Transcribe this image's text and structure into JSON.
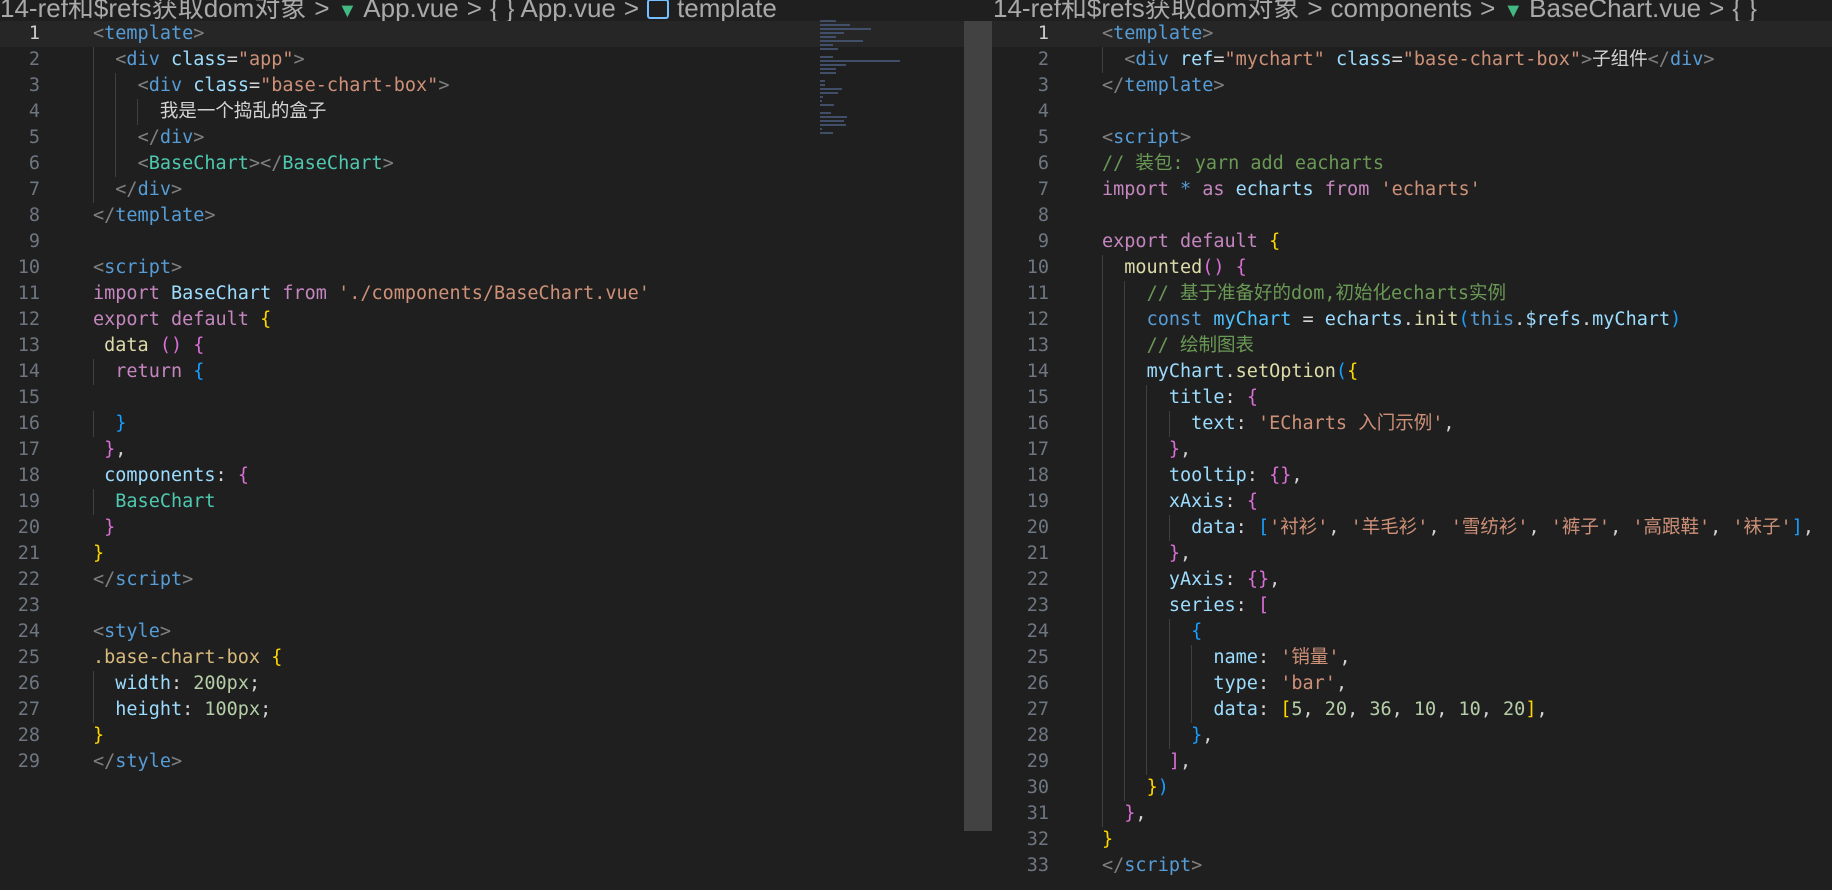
{
  "left_editor": {
    "breadcrumb": {
      "folder": "14-ref和$refs获取dom对象",
      "file": "App.vue",
      "symbol_file": "App.vue",
      "symbol": "template"
    },
    "active_line": 1,
    "line_numbers": [
      "1",
      "2",
      "3",
      "4",
      "5",
      "6",
      "7",
      "8",
      "9",
      "10",
      "11",
      "12",
      "13",
      "14",
      "15",
      "16",
      "17",
      "18",
      "19",
      "20",
      "21",
      "22",
      "23",
      "24",
      "25",
      "26",
      "27",
      "28",
      "29"
    ]
  },
  "right_editor": {
    "breadcrumb": {
      "folder": "14-ref和$refs获取dom对象",
      "subfolder": "components",
      "file": "BaseChart.vue",
      "symbol_file": "{ }"
    },
    "active_line": 1,
    "line_numbers": [
      "1",
      "2",
      "3",
      "4",
      "5",
      "6",
      "7",
      "8",
      "9",
      "10",
      "11",
      "12",
      "13",
      "14",
      "15",
      "16",
      "17",
      "18",
      "19",
      "20",
      "21",
      "22",
      "23",
      "24",
      "25",
      "26",
      "27",
      "28",
      "29",
      "30",
      "31",
      "32",
      "33"
    ]
  },
  "left_code": [
    [
      [
        "tg",
        "<"
      ],
      [
        "tn",
        "template"
      ],
      [
        "tg",
        ">"
      ]
    ],
    [
      [
        "tx",
        "  "
      ],
      [
        "tg",
        "<"
      ],
      [
        "tn",
        "div"
      ],
      [
        "tx",
        " "
      ],
      [
        "an",
        "class"
      ],
      [
        "tx",
        "="
      ],
      [
        "sv",
        "\"app\""
      ],
      [
        "tg",
        ">"
      ]
    ],
    [
      [
        "tx",
        "    "
      ],
      [
        "tg",
        "<"
      ],
      [
        "tn",
        "div"
      ],
      [
        "tx",
        " "
      ],
      [
        "an",
        "class"
      ],
      [
        "tx",
        "="
      ],
      [
        "sv",
        "\"base-chart-box\""
      ],
      [
        "tg",
        ">"
      ]
    ],
    [
      [
        "tx",
        "      我是一个捣乱的盒子"
      ]
    ],
    [
      [
        "tx",
        "    "
      ],
      [
        "tg",
        "</"
      ],
      [
        "tn",
        "div"
      ],
      [
        "tg",
        ">"
      ]
    ],
    [
      [
        "tx",
        "    "
      ],
      [
        "tg",
        "<"
      ],
      [
        "cl",
        "BaseChart"
      ],
      [
        "tg",
        "></"
      ],
      [
        "cl",
        "BaseChart"
      ],
      [
        "tg",
        ">"
      ]
    ],
    [
      [
        "tx",
        "  "
      ],
      [
        "tg",
        "</"
      ],
      [
        "tn",
        "div"
      ],
      [
        "tg",
        ">"
      ]
    ],
    [
      [
        "tg",
        "</"
      ],
      [
        "tn",
        "template"
      ],
      [
        "tg",
        ">"
      ]
    ],
    [],
    [
      [
        "tg",
        "<"
      ],
      [
        "tn",
        "script"
      ],
      [
        "tg",
        ">"
      ]
    ],
    [
      [
        "kw",
        "import"
      ],
      [
        "tx",
        " "
      ],
      [
        "an",
        "BaseChart"
      ],
      [
        "tx",
        " "
      ],
      [
        "kw",
        "from"
      ],
      [
        "tx",
        " "
      ],
      [
        "sv",
        "'./components/BaseChart.vue'"
      ]
    ],
    [
      [
        "kw",
        "export"
      ],
      [
        "tx",
        " "
      ],
      [
        "kw",
        "default"
      ],
      [
        "tx",
        " "
      ],
      [
        "p1",
        "{"
      ]
    ],
    [
      [
        "tx",
        " "
      ],
      [
        "fn",
        "data"
      ],
      [
        "tx",
        " "
      ],
      [
        "p2",
        "()"
      ],
      [
        "tx",
        " "
      ],
      [
        "p2",
        "{"
      ]
    ],
    [
      [
        "tx",
        "  "
      ],
      [
        "kw",
        "return"
      ],
      [
        "tx",
        " "
      ],
      [
        "p3",
        "{"
      ]
    ],
    [],
    [
      [
        "tx",
        "  "
      ],
      [
        "p3",
        "}"
      ]
    ],
    [
      [
        "tx",
        " "
      ],
      [
        "p2",
        "}"
      ],
      [
        "tx",
        ","
      ]
    ],
    [
      [
        "tx",
        " "
      ],
      [
        "pr",
        "components"
      ],
      [
        "tx",
        ": "
      ],
      [
        "p2",
        "{"
      ]
    ],
    [
      [
        "tx",
        "  "
      ],
      [
        "cl",
        "BaseChart"
      ]
    ],
    [
      [
        "tx",
        " "
      ],
      [
        "p2",
        "}"
      ]
    ],
    [
      [
        "p1",
        "}"
      ]
    ],
    [
      [
        "tg",
        "</"
      ],
      [
        "tn",
        "script"
      ],
      [
        "tg",
        ">"
      ]
    ],
    [],
    [
      [
        "tg",
        "<"
      ],
      [
        "tn",
        "style"
      ],
      [
        "tg",
        ">"
      ]
    ],
    [
      [
        "sel",
        ".base-chart-box"
      ],
      [
        "tx",
        " "
      ],
      [
        "p1",
        "{"
      ]
    ],
    [
      [
        "tx",
        "  "
      ],
      [
        "pr",
        "width"
      ],
      [
        "tx",
        ": "
      ],
      [
        "nm",
        "200px"
      ],
      [
        "tx",
        ";"
      ]
    ],
    [
      [
        "tx",
        "  "
      ],
      [
        "pr",
        "height"
      ],
      [
        "tx",
        ": "
      ],
      [
        "nm",
        "100px"
      ],
      [
        "tx",
        ";"
      ]
    ],
    [
      [
        "p1",
        "}"
      ]
    ],
    [
      [
        "tg",
        "</"
      ],
      [
        "tn",
        "style"
      ],
      [
        "tg",
        ">"
      ]
    ]
  ],
  "right_code": [
    [
      [
        "tg",
        "<"
      ],
      [
        "tn",
        "template"
      ],
      [
        "tg",
        ">"
      ]
    ],
    [
      [
        "tx",
        "  "
      ],
      [
        "tg",
        "<"
      ],
      [
        "tn",
        "div"
      ],
      [
        "tx",
        " "
      ],
      [
        "an",
        "ref"
      ],
      [
        "tx",
        "="
      ],
      [
        "sv",
        "\"mychart\""
      ],
      [
        "tx",
        " "
      ],
      [
        "an",
        "class"
      ],
      [
        "tx",
        "="
      ],
      [
        "sv",
        "\"base-chart-box\""
      ],
      [
        "tg",
        ">"
      ],
      [
        "tx",
        "子组件"
      ],
      [
        "tg",
        "</"
      ],
      [
        "tn",
        "div"
      ],
      [
        "tg",
        ">"
      ]
    ],
    [
      [
        "tg",
        "</"
      ],
      [
        "tn",
        "template"
      ],
      [
        "tg",
        ">"
      ]
    ],
    [],
    [
      [
        "tg",
        "<"
      ],
      [
        "tn",
        "script"
      ],
      [
        "tg",
        ">"
      ]
    ],
    [
      [
        "cm",
        "// 装包: yarn add eacharts"
      ]
    ],
    [
      [
        "kw",
        "import"
      ],
      [
        "tx",
        " "
      ],
      [
        "kb",
        "*"
      ],
      [
        "tx",
        " "
      ],
      [
        "kw",
        "as"
      ],
      [
        "tx",
        " "
      ],
      [
        "an",
        "echarts"
      ],
      [
        "tx",
        " "
      ],
      [
        "kw",
        "from"
      ],
      [
        "tx",
        " "
      ],
      [
        "sv",
        "'echarts'"
      ]
    ],
    [],
    [
      [
        "kw",
        "export"
      ],
      [
        "tx",
        " "
      ],
      [
        "kw",
        "default"
      ],
      [
        "tx",
        " "
      ],
      [
        "p1",
        "{"
      ]
    ],
    [
      [
        "tx",
        "  "
      ],
      [
        "fn",
        "mounted"
      ],
      [
        "p2",
        "()"
      ],
      [
        "tx",
        " "
      ],
      [
        "p2",
        "{"
      ]
    ],
    [
      [
        "tx",
        "    "
      ],
      [
        "cm",
        "// 基于准备好的dom,初始化echarts实例"
      ]
    ],
    [
      [
        "tx",
        "    "
      ],
      [
        "kb",
        "const"
      ],
      [
        "tx",
        " "
      ],
      [
        "vr",
        "myChart"
      ],
      [
        "tx",
        " = "
      ],
      [
        "an",
        "echarts"
      ],
      [
        "tx",
        "."
      ],
      [
        "fn",
        "init"
      ],
      [
        "p3",
        "("
      ],
      [
        "kb",
        "this"
      ],
      [
        "tx",
        "."
      ],
      [
        "an",
        "$refs"
      ],
      [
        "tx",
        "."
      ],
      [
        "an",
        "myChart"
      ],
      [
        "p3",
        ")"
      ]
    ],
    [
      [
        "tx",
        "    "
      ],
      [
        "cm",
        "// 绘制图表"
      ]
    ],
    [
      [
        "tx",
        "    "
      ],
      [
        "an",
        "myChart"
      ],
      [
        "tx",
        "."
      ],
      [
        "fn",
        "setOption"
      ],
      [
        "p3",
        "("
      ],
      [
        "p1",
        "{"
      ]
    ],
    [
      [
        "tx",
        "      "
      ],
      [
        "pr",
        "title"
      ],
      [
        "tx",
        ": "
      ],
      [
        "p2",
        "{"
      ]
    ],
    [
      [
        "tx",
        "        "
      ],
      [
        "pr",
        "text"
      ],
      [
        "tx",
        ": "
      ],
      [
        "sv",
        "'ECharts 入门示例'"
      ],
      [
        "tx",
        ","
      ]
    ],
    [
      [
        "tx",
        "      "
      ],
      [
        "p2",
        "}"
      ],
      [
        "tx",
        ","
      ]
    ],
    [
      [
        "tx",
        "      "
      ],
      [
        "pr",
        "tooltip"
      ],
      [
        "tx",
        ": "
      ],
      [
        "p2",
        "{}"
      ],
      [
        "tx",
        ","
      ]
    ],
    [
      [
        "tx",
        "      "
      ],
      [
        "pr",
        "xAxis"
      ],
      [
        "tx",
        ": "
      ],
      [
        "p2",
        "{"
      ]
    ],
    [
      [
        "tx",
        "        "
      ],
      [
        "pr",
        "data"
      ],
      [
        "tx",
        ": "
      ],
      [
        "p3",
        "["
      ],
      [
        "sv",
        "'衬衫'"
      ],
      [
        "tx",
        ", "
      ],
      [
        "sv",
        "'羊毛衫'"
      ],
      [
        "tx",
        ", "
      ],
      [
        "sv",
        "'雪纺衫'"
      ],
      [
        "tx",
        ", "
      ],
      [
        "sv",
        "'裤子'"
      ],
      [
        "tx",
        ", "
      ],
      [
        "sv",
        "'高跟鞋'"
      ],
      [
        "tx",
        ", "
      ],
      [
        "sv",
        "'袜子'"
      ],
      [
        "p3",
        "]"
      ],
      [
        "tx",
        ","
      ]
    ],
    [
      [
        "tx",
        "      "
      ],
      [
        "p2",
        "}"
      ],
      [
        "tx",
        ","
      ]
    ],
    [
      [
        "tx",
        "      "
      ],
      [
        "pr",
        "yAxis"
      ],
      [
        "tx",
        ": "
      ],
      [
        "p2",
        "{}"
      ],
      [
        "tx",
        ","
      ]
    ],
    [
      [
        "tx",
        "      "
      ],
      [
        "pr",
        "series"
      ],
      [
        "tx",
        ": "
      ],
      [
        "p2",
        "["
      ]
    ],
    [
      [
        "tx",
        "        "
      ],
      [
        "p3",
        "{"
      ]
    ],
    [
      [
        "tx",
        "          "
      ],
      [
        "pr",
        "name"
      ],
      [
        "tx",
        ": "
      ],
      [
        "sv",
        "'销量'"
      ],
      [
        "tx",
        ","
      ]
    ],
    [
      [
        "tx",
        "          "
      ],
      [
        "pr",
        "type"
      ],
      [
        "tx",
        ": "
      ],
      [
        "sv",
        "'bar'"
      ],
      [
        "tx",
        ","
      ]
    ],
    [
      [
        "tx",
        "          "
      ],
      [
        "pr",
        "data"
      ],
      [
        "tx",
        ": "
      ],
      [
        "p1",
        "["
      ],
      [
        "nm",
        "5"
      ],
      [
        "tx",
        ", "
      ],
      [
        "nm",
        "20"
      ],
      [
        "tx",
        ", "
      ],
      [
        "nm",
        "36"
      ],
      [
        "tx",
        ", "
      ],
      [
        "nm",
        "10"
      ],
      [
        "tx",
        ", "
      ],
      [
        "nm",
        "10"
      ],
      [
        "tx",
        ", "
      ],
      [
        "nm",
        "20"
      ],
      [
        "p1",
        "]"
      ],
      [
        "tx",
        ","
      ]
    ],
    [
      [
        "tx",
        "        "
      ],
      [
        "p3",
        "}"
      ],
      [
        "tx",
        ","
      ]
    ],
    [
      [
        "tx",
        "      "
      ],
      [
        "p2",
        "]"
      ],
      [
        "tx",
        ","
      ]
    ],
    [
      [
        "tx",
        "    "
      ],
      [
        "p1",
        "}"
      ],
      [
        "p3",
        ")"
      ]
    ],
    [
      [
        "tx",
        "  "
      ],
      [
        "p2",
        "}"
      ],
      [
        "tx",
        ","
      ]
    ],
    [
      [
        "p1",
        "}"
      ]
    ],
    [
      [
        "tg",
        "</"
      ],
      [
        "tn",
        "script"
      ],
      [
        "tg",
        ">"
      ]
    ]
  ]
}
